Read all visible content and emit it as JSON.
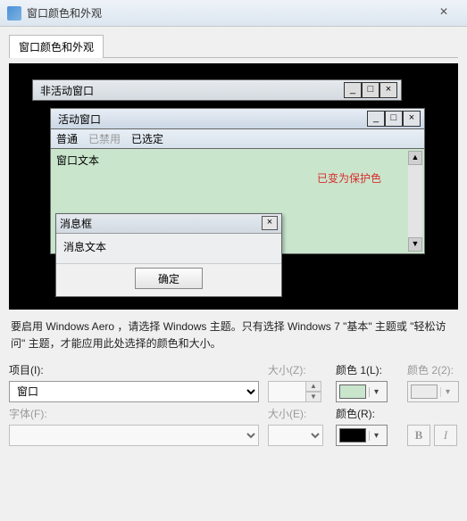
{
  "window": {
    "title": "窗口颜色和外观",
    "close_glyph": "✕"
  },
  "tab": {
    "label": "窗口颜色和外观"
  },
  "preview": {
    "inactive_title": "非活动窗口",
    "active_title": "活动窗口",
    "menu": {
      "normal": "普通",
      "disabled": "已禁用",
      "selected": "已选定"
    },
    "content_text": "窗口文本",
    "protect_text": "已变为保护色",
    "msgbox": {
      "title": "消息框",
      "body": "消息文本",
      "ok": "确定",
      "close_glyph": "×"
    },
    "winbtn": {
      "min": "_",
      "max": "□",
      "close": "×"
    }
  },
  "description": "要启用 Windows Aero ，请选择 Windows 主题。只有选择 Windows 7 \"基本\" 主题或 \"轻松访问\" 主题，才能应用此处选择的颜色和大小。",
  "form": {
    "item_label": "项目(I):",
    "item_value": "窗口",
    "size_z_label": "大小(Z):",
    "color1_label": "颜色 1(L):",
    "color2_label": "颜色 2(2):",
    "font_label": "字体(F):",
    "size_e_label": "大小(E):",
    "color_r_label": "颜色(R):",
    "color1_swatch": "#c9e6cd",
    "color_r_swatch": "#000000"
  }
}
